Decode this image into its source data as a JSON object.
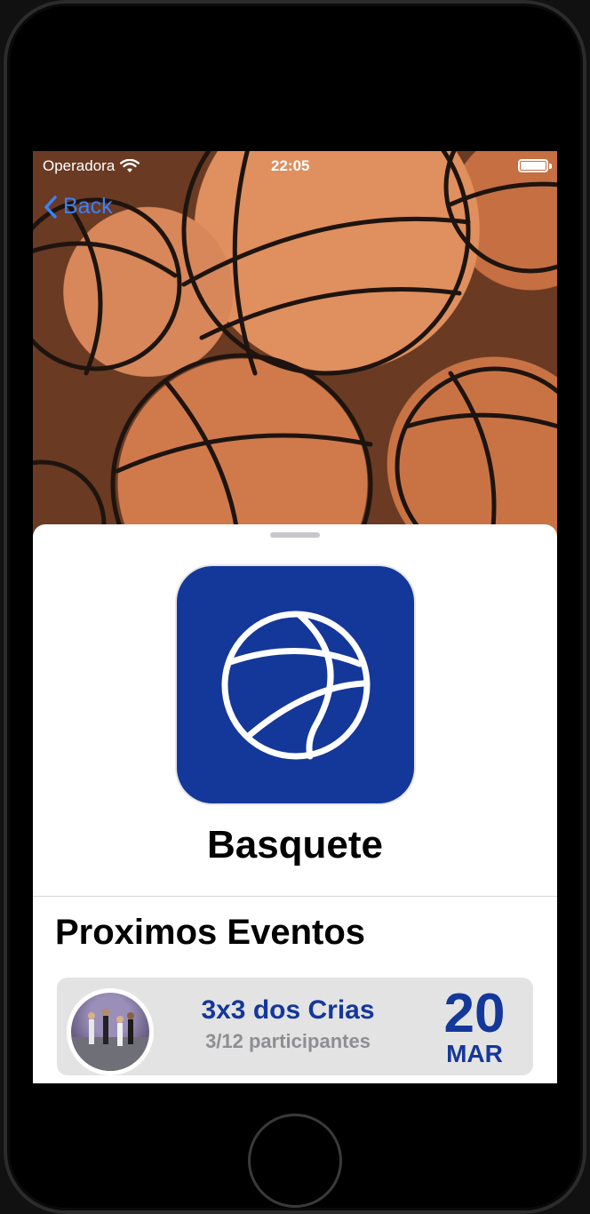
{
  "status_bar": {
    "carrier": "Operadora",
    "time": "22:05"
  },
  "nav": {
    "back_label": "Back"
  },
  "sport": {
    "name": "Basquete",
    "icon": "basketball-icon",
    "icon_background": "#14379a"
  },
  "events_section": {
    "title": "Proximos Eventos",
    "events": [
      {
        "name": "3x3 dos Crias",
        "participants": "3/12 participantes",
        "day": "20",
        "month": "MAR"
      }
    ]
  },
  "colors": {
    "accent": "#14379a",
    "back_link": "#3b82f6",
    "muted_text": "#8e8e93",
    "card_background": "#e3e3e3"
  }
}
